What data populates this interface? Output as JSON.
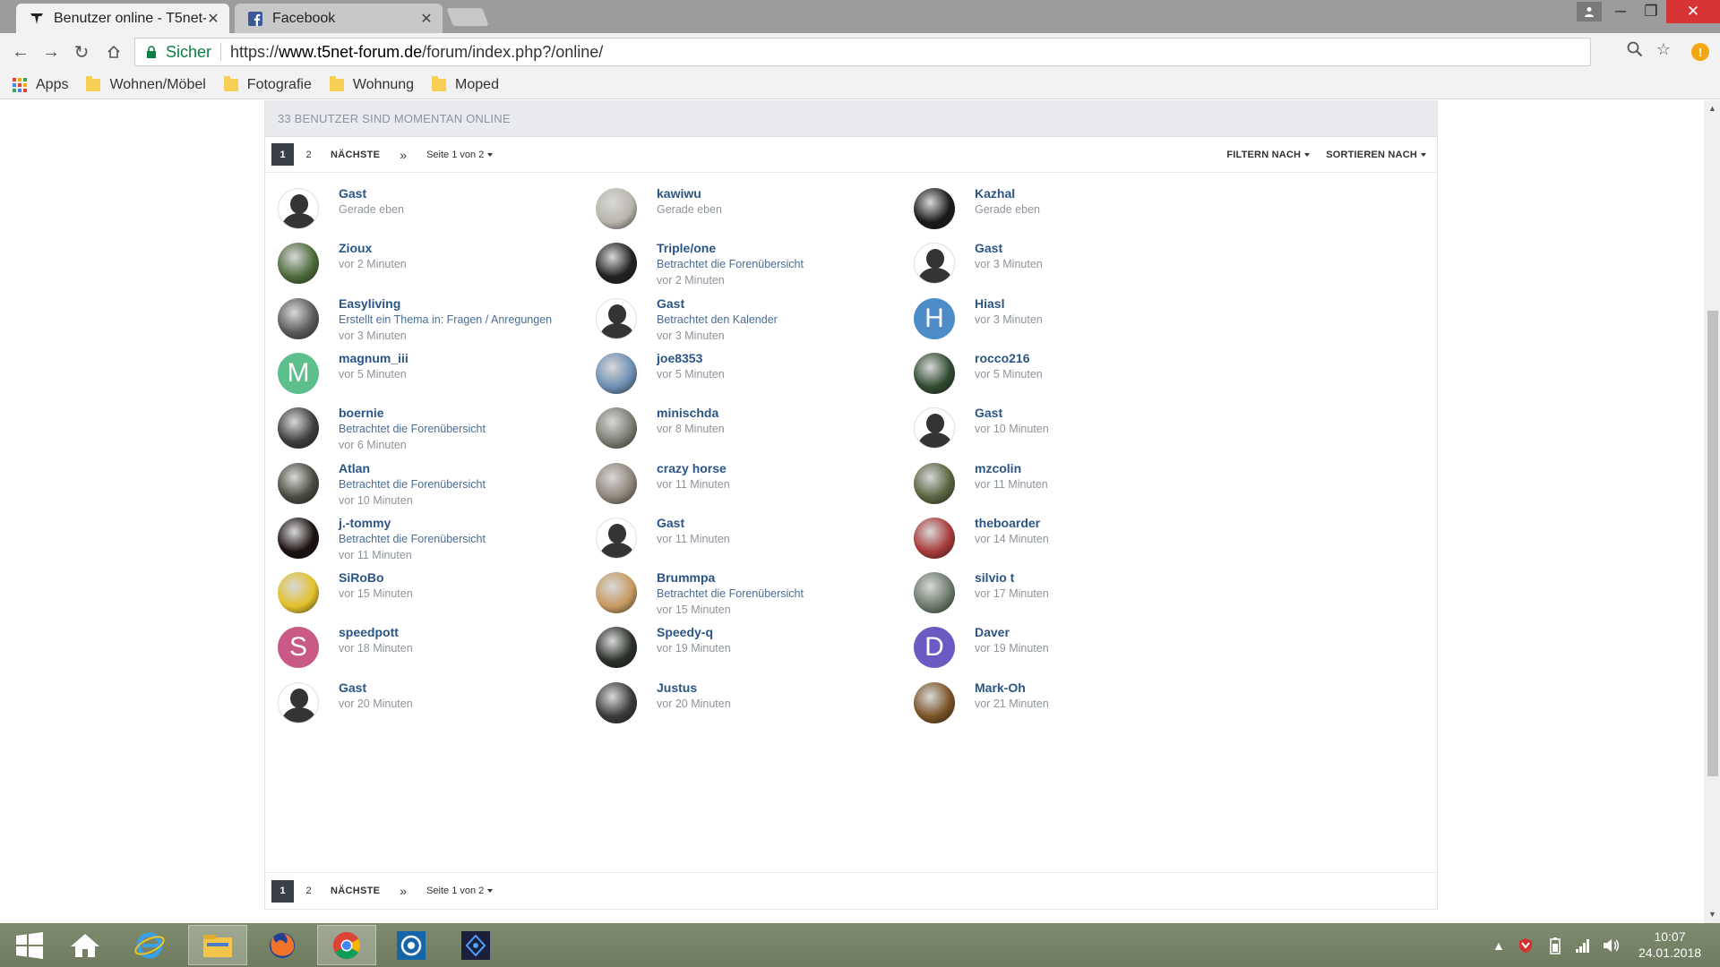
{
  "browser": {
    "tabs": [
      {
        "title": "Benutzer online - T5net-",
        "active": true
      },
      {
        "title": "Facebook",
        "active": false
      }
    ],
    "secure_label": "Sicher",
    "url_prefix": "https://",
    "url_host": "www.t5net-forum.de",
    "url_path": "/forum/index.php?/online/",
    "bookmarks": [
      "Apps",
      "Wohnen/Möbel",
      "Fotografie",
      "Wohnung",
      "Moped"
    ]
  },
  "page": {
    "header": "33 BENUTZER SIND MOMENTAN ONLINE",
    "pagination": {
      "pages": [
        "1",
        "2"
      ],
      "next": "NÄCHSTE",
      "last": "»",
      "page_info": "Seite 1 von 2",
      "filter": "FILTERN NACH",
      "sort": "SORTIEREN NACH"
    },
    "users": [
      {
        "name": "Gast",
        "activity": "",
        "time": "Gerade eben",
        "avatar": "guest"
      },
      {
        "name": "kawiwu",
        "activity": "",
        "time": "Gerade eben",
        "avatar": "photo",
        "color": "#b9b6ad"
      },
      {
        "name": "Kazhal",
        "activity": "",
        "time": "Gerade eben",
        "avatar": "photo",
        "color": "#1a1a1a"
      },
      {
        "name": "Zioux",
        "activity": "",
        "time": "vor 2 Minuten",
        "avatar": "photo",
        "color": "#4d6b3a"
      },
      {
        "name": "Triple/one",
        "activity": "Betrachtet die Forenübersicht",
        "time": "vor 2 Minuten",
        "avatar": "photo",
        "color": "#222222"
      },
      {
        "name": "Gast",
        "activity": "",
        "time": "vor 3 Minuten",
        "avatar": "guest"
      },
      {
        "name": "Easyliving",
        "activity": "Erstellt ein Thema in: Fragen / Anregungen",
        "time": "vor 3 Minuten",
        "avatar": "photo",
        "color": "#5a5a5a"
      },
      {
        "name": "Gast",
        "activity": "Betrachtet den Kalender",
        "time": "vor 3 Minuten",
        "avatar": "guest"
      },
      {
        "name": "Hiasl",
        "activity": "",
        "time": "vor 3 Minuten",
        "avatar": "letter",
        "letter": "H",
        "color": "#4e8cc7"
      },
      {
        "name": "magnum_iii",
        "activity": "",
        "time": "vor 5 Minuten",
        "avatar": "letter",
        "letter": "M",
        "color": "#5cbf8c"
      },
      {
        "name": "joe8353",
        "activity": "",
        "time": "vor 5 Minuten",
        "avatar": "photo",
        "color": "#6d8fb3"
      },
      {
        "name": "rocco216",
        "activity": "",
        "time": "vor 5 Minuten",
        "avatar": "photo",
        "color": "#2f4a2f"
      },
      {
        "name": "boernie",
        "activity": "Betrachtet die Forenübersicht",
        "time": "vor 6 Minuten",
        "avatar": "photo",
        "color": "#3d3d3d"
      },
      {
        "name": "minischda",
        "activity": "",
        "time": "vor 8 Minuten",
        "avatar": "photo",
        "color": "#7a7d72"
      },
      {
        "name": "Gast",
        "activity": "",
        "time": "vor 10 Minuten",
        "avatar": "guest"
      },
      {
        "name": "Atlan",
        "activity": "Betrachtet die Forenübersicht",
        "time": "vor 10 Minuten",
        "avatar": "photo",
        "color": "#4a4a40"
      },
      {
        "name": "crazy horse",
        "activity": "",
        "time": "vor 11 Minuten",
        "avatar": "photo",
        "color": "#8f8579"
      },
      {
        "name": "mzcolin",
        "activity": "",
        "time": "vor 11 Minuten",
        "avatar": "photo",
        "color": "#59643f"
      },
      {
        "name": "j.-tommy",
        "activity": "Betrachtet die Forenübersicht",
        "time": "vor 11 Minuten",
        "avatar": "photo",
        "color": "#1c1212"
      },
      {
        "name": "Gast",
        "activity": "",
        "time": "vor 11 Minuten",
        "avatar": "guest"
      },
      {
        "name": "theboarder",
        "activity": "",
        "time": "vor 14 Minuten",
        "avatar": "photo",
        "color": "#a83a3a"
      },
      {
        "name": "SiRoBo",
        "activity": "",
        "time": "vor 15 Minuten",
        "avatar": "photo",
        "color": "#e3c12a"
      },
      {
        "name": "Brummpa",
        "activity": "Betrachtet die Forenübersicht",
        "time": "vor 15 Minuten",
        "avatar": "photo",
        "color": "#c79a62"
      },
      {
        "name": "silvio t",
        "activity": "",
        "time": "vor 17 Minuten",
        "avatar": "photo",
        "color": "#6b7a6b"
      },
      {
        "name": "speedpott",
        "activity": "",
        "time": "vor 18 Minuten",
        "avatar": "letter",
        "letter": "S",
        "color": "#c95a86"
      },
      {
        "name": "Speedy-q",
        "activity": "",
        "time": "vor 19 Minuten",
        "avatar": "photo",
        "color": "#2a302a"
      },
      {
        "name": "Daver",
        "activity": "",
        "time": "vor 19 Minuten",
        "avatar": "letter",
        "letter": "D",
        "color": "#6a5ac2"
      },
      {
        "name": "Gast",
        "activity": "",
        "time": "vor 20 Minuten",
        "avatar": "guest"
      },
      {
        "name": "Justus",
        "activity": "",
        "time": "vor 20 Minuten",
        "avatar": "photo",
        "color": "#3a3a3a"
      },
      {
        "name": "Mark-Oh",
        "activity": "",
        "time": "vor 21 Minuten",
        "avatar": "photo",
        "color": "#7a5326"
      }
    ]
  },
  "taskbar": {
    "time": "10:07",
    "date": "24.01.2018"
  }
}
